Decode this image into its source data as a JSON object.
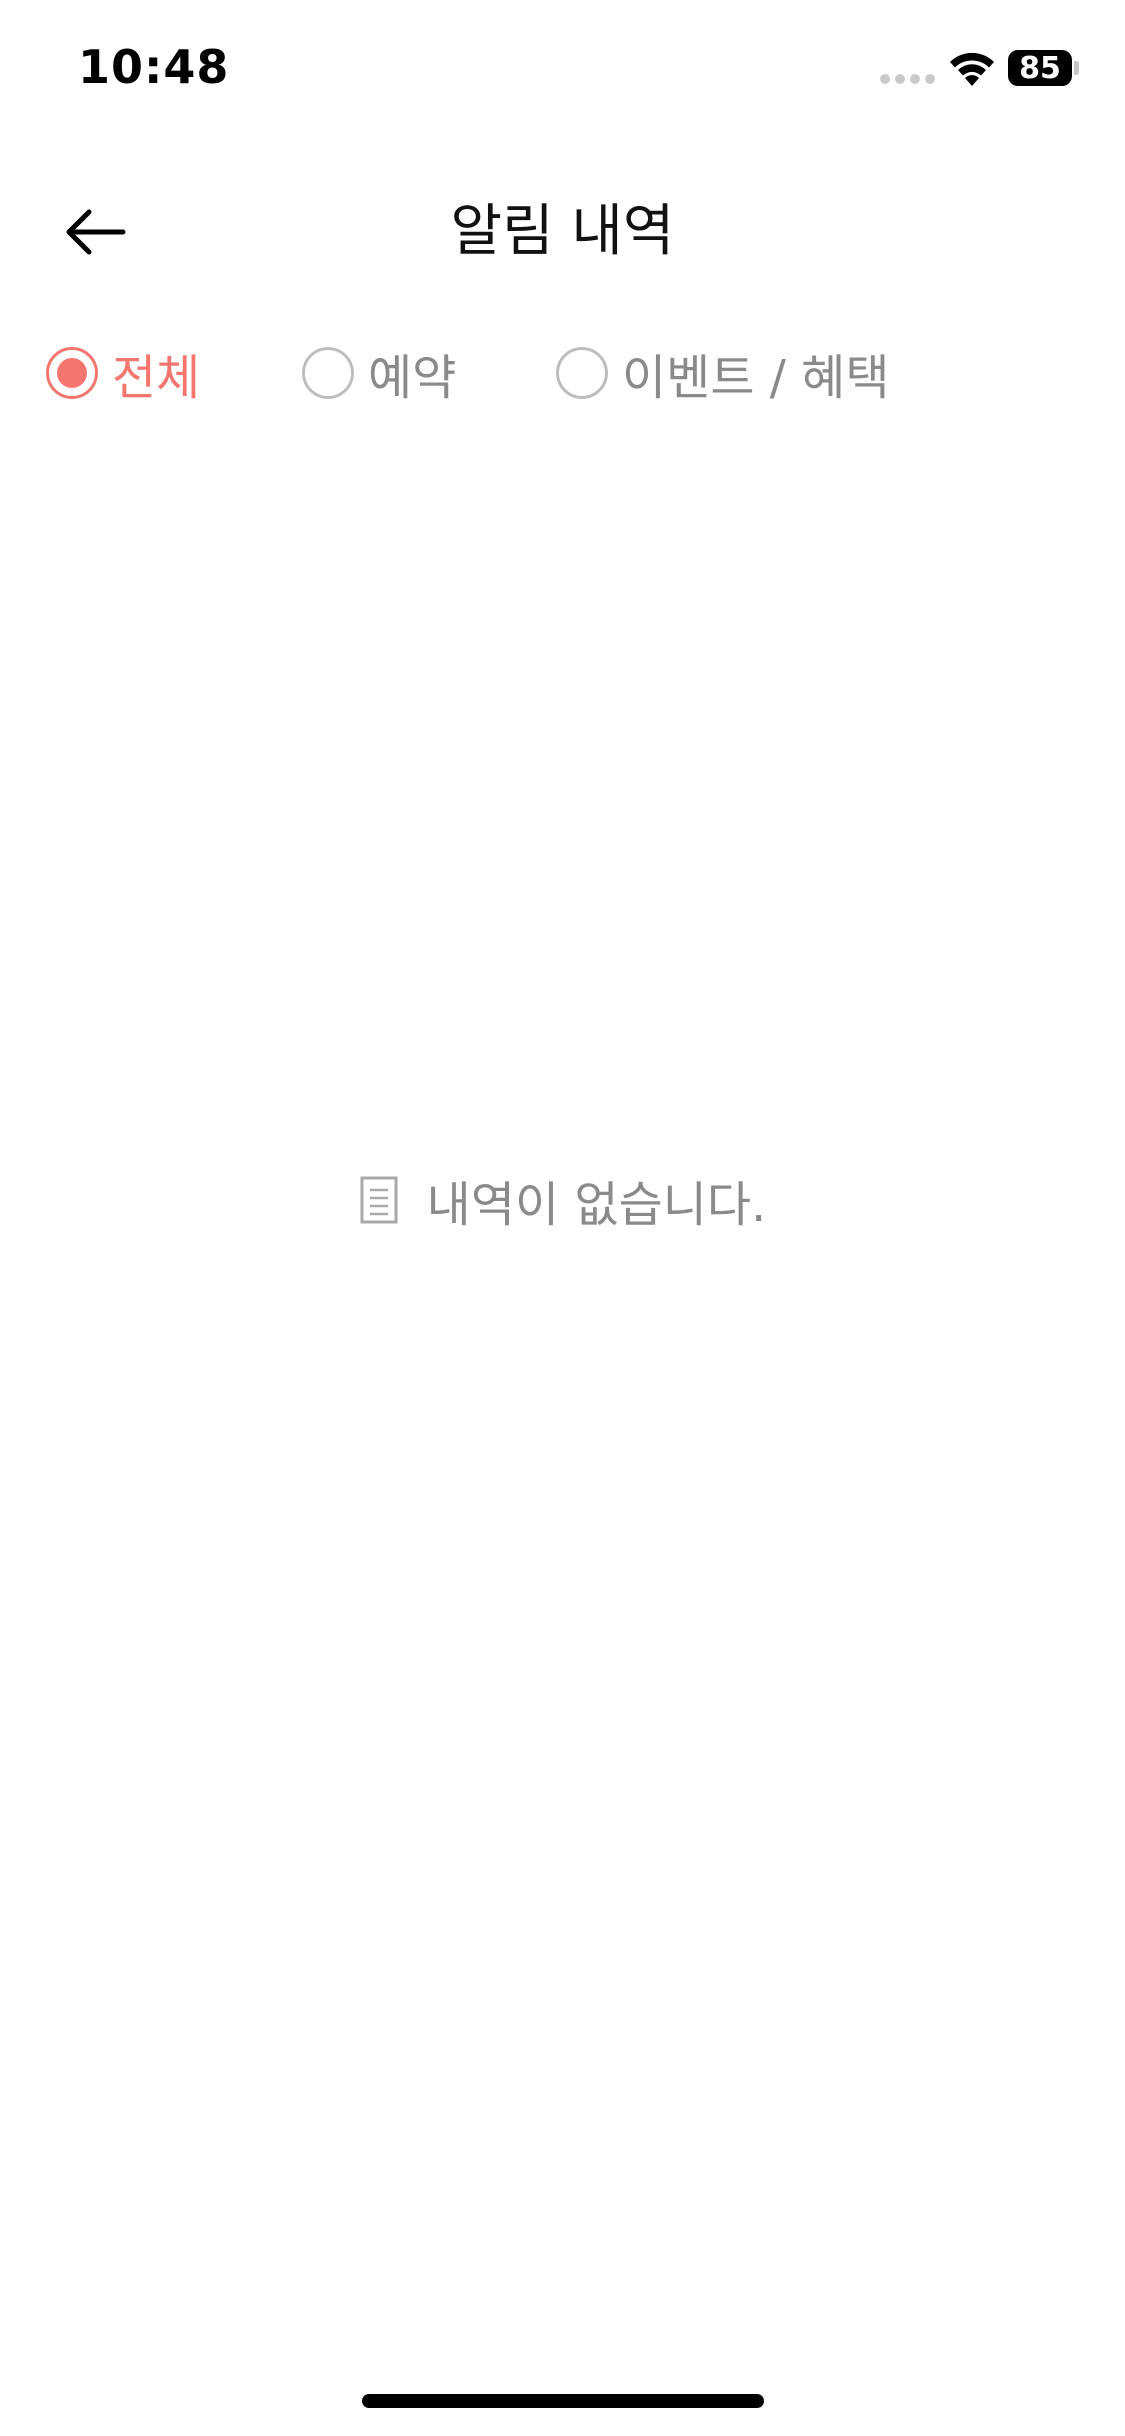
{
  "status_bar": {
    "time": "10:48",
    "battery_level": "85"
  },
  "header": {
    "title": "알림 내역",
    "back_icon": "arrow-left-icon"
  },
  "filters": {
    "options": [
      {
        "label": "전체",
        "selected": true
      },
      {
        "label": "예약",
        "selected": false
      },
      {
        "label": "이벤트 / 혜택",
        "selected": false
      }
    ]
  },
  "empty_state": {
    "icon": "document-icon",
    "message": "내역이 없습니다."
  },
  "colors": {
    "accent": "#f4766f",
    "muted_text": "#8a8a8a",
    "radio_border": "#bdbdbd"
  }
}
